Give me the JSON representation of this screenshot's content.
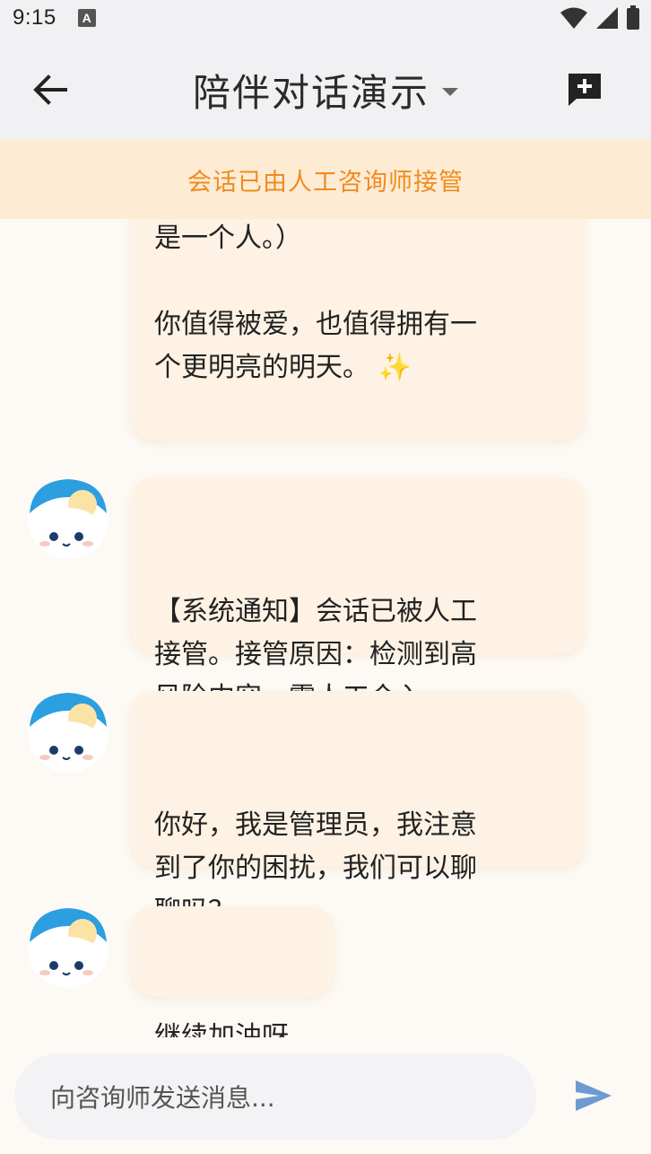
{
  "status_bar": {
    "time": "9:15",
    "notification_icon_letter": "A"
  },
  "app_bar": {
    "title": "陪伴对话演示"
  },
  "banner": {
    "text": "会话已由人工咨询师接管"
  },
  "messages": [
    {
      "id": "m1",
      "text": "当地的心理援助热线——你不\n是一个人。）\n\n你值得被爱，也值得拥有一\n个更明亮的明天。 ✨"
    },
    {
      "id": "m2",
      "text": "【系统通知】会话已被人工\n接管。接管原因：检测到高\n风险内容，需人工介入"
    },
    {
      "id": "m3",
      "text": "你好，我是管理员，我注意\n到了你的困扰，我们可以聊\n聊吗？"
    },
    {
      "id": "m4",
      "text": "继续加油呀"
    }
  ],
  "input": {
    "placeholder": "向咨询师发送消息..."
  },
  "colors": {
    "banner_bg": "#fdebd4",
    "banner_text": "#ef8c1e",
    "bubble_bg": "#fdf2e4",
    "send_icon": "#6f9ad0",
    "avatar_blue": "#2b9fe0"
  },
  "icons": {
    "back": "arrow-left-icon",
    "new_chat": "add-comment-icon",
    "send": "send-icon",
    "title_dropdown": "caret-down-icon",
    "wifi": "wifi-icon",
    "signal": "signal-icon",
    "battery": "battery-icon"
  }
}
